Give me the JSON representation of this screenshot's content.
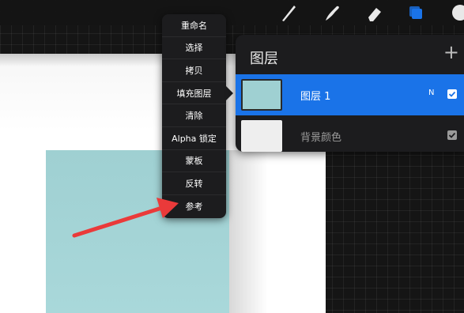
{
  "toolbar": {
    "tools": [
      {
        "icon": "brush-icon"
      },
      {
        "icon": "smudge-icon"
      },
      {
        "icon": "eraser-icon"
      },
      {
        "icon": "layers-icon"
      },
      {
        "icon": "color-icon"
      }
    ]
  },
  "context_menu": {
    "items": [
      {
        "label": "重命名"
      },
      {
        "label": "选择"
      },
      {
        "label": "拷贝"
      },
      {
        "label": "填充图层"
      },
      {
        "label": "清除"
      },
      {
        "label": "Alpha 锁定"
      },
      {
        "label": "蒙板"
      },
      {
        "label": "反转"
      },
      {
        "label": "参考"
      }
    ]
  },
  "layers_panel": {
    "title": "图层",
    "add_symbol": "+",
    "layers": [
      {
        "name": "图层 1",
        "blend_mode": "N",
        "visible": true,
        "selected": true,
        "thumb_color": "#9fd0d2"
      },
      {
        "name": "背景颜色",
        "visible": true,
        "selected": false,
        "thumb_color": "#eeeeee"
      }
    ]
  },
  "colors": {
    "accent": "#1a73e8",
    "canvas_fill": "#9fd0d2",
    "arrow": "#ea3a3a"
  }
}
